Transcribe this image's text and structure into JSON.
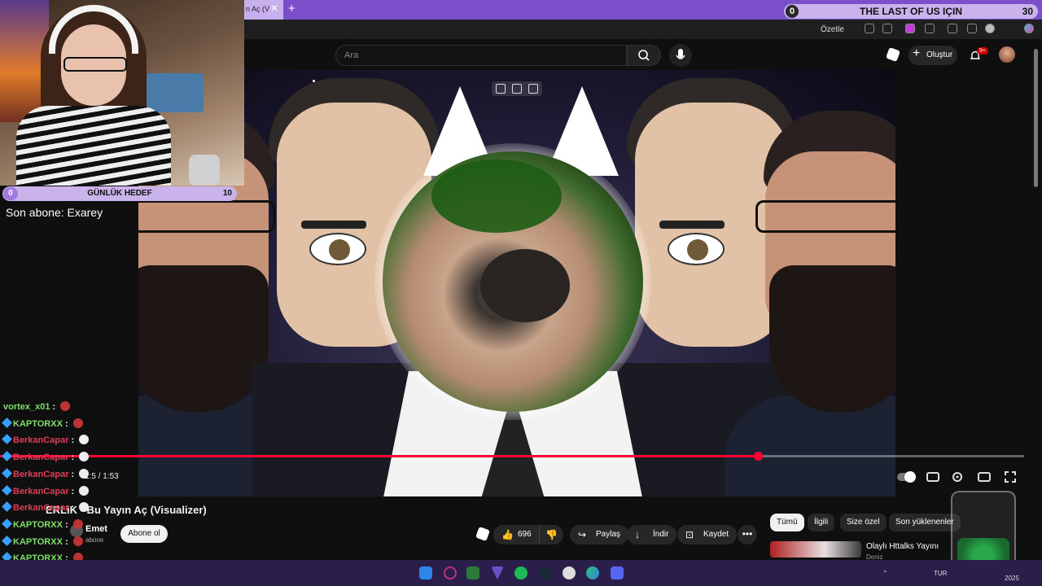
{
  "browser": {
    "tab_title": "n Aç (V",
    "tab_close": "✕",
    "new_tab": "+",
    "ozetle_label": "Özetle"
  },
  "goal_top": {
    "current": "0",
    "title": "THE LAST OF US IÇIN",
    "target": "30"
  },
  "youtube": {
    "search_placeholder": "Ara",
    "create_label": "Oluştur",
    "notif_count": "9+",
    "video_title": "ERLiK - Bu Yayın Aç (Visualizer)",
    "channel_name": "Emet",
    "channel_subs": "abone",
    "subscribe_label": "Abone ol",
    "like_count": "696",
    "share_label": "Paylaş",
    "download_label": "İndir",
    "save_label": "Kaydet",
    "more_label": "•••",
    "time_display": "1:5 / 1:53",
    "progress": 0.74,
    "chips": [
      "Tümü",
      "İlgili",
      "Size özel",
      "Son yüklenenler"
    ],
    "rec_title": "Olaylı Httalks Yayını",
    "rec_sub": "Deniz"
  },
  "stream": {
    "goal": {
      "current": "0",
      "title": "GÜNLÜK HEDEF",
      "target": "10"
    },
    "last_sub": "Son abone: Exarey"
  },
  "chat": [
    {
      "user": "vortex_x01",
      "color": "#7ee06a"
    },
    {
      "user": "KAPTORXX",
      "color": "#7ee06a"
    },
    {
      "user": "BerkanCapar",
      "color": "#e03c5a"
    },
    {
      "user": "BerkanCapar",
      "color": "#e03c5a"
    },
    {
      "user": "BerkanCapar",
      "color": "#e03c5a"
    },
    {
      "user": "BerkanCapar",
      "color": "#e03c5a"
    },
    {
      "user": "BerkanCapar",
      "color": "#e03c5a"
    },
    {
      "user": "KAPTORXX",
      "color": "#7ee06a"
    },
    {
      "user": "KAPTORXX",
      "color": "#7ee06a"
    },
    {
      "user": "KAPTORXX",
      "color": "#7ee06a"
    },
    {
      "user": "KAPTORXX",
      "color": "#7ee06a"
    }
  ],
  "taskbar": {
    "lang": "TUR",
    "year": "2025"
  },
  "colors": {
    "accent": "#ff0033",
    "tabstrip": "#7b4fc9",
    "goal": "#c9b3ea"
  }
}
